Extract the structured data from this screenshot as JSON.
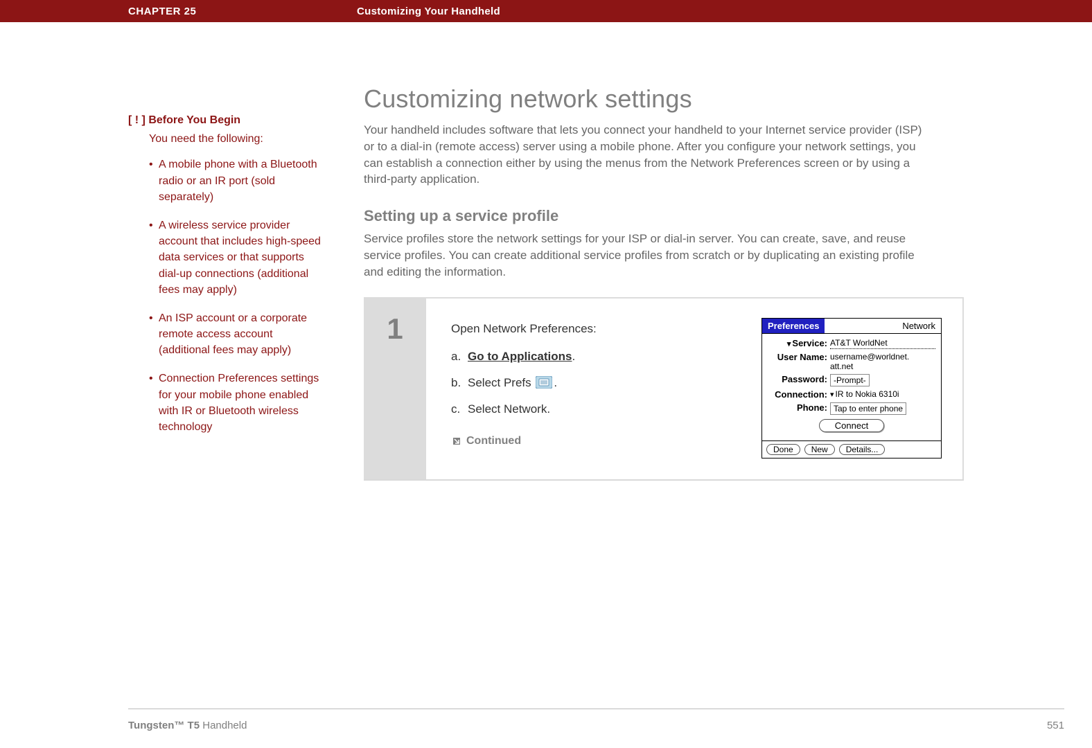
{
  "header": {
    "chapter": "CHAPTER 25",
    "title": "Customizing Your Handheld"
  },
  "sidebar": {
    "bracket_open": "[",
    "bang": " ! ",
    "bracket_close": "]",
    "label": " Before You Begin",
    "intro": "You need the following:",
    "items": [
      "A mobile phone with a Bluetooth radio or an IR port (sold separately)",
      "A wireless service provider account that includes high-speed data services or that supports dial-up connections (additional fees may apply)",
      "An ISP account or a corporate remote access account (additional fees may apply)",
      "Connection Preferences settings for your mobile phone enabled with IR or Bluetooth wireless technology"
    ]
  },
  "main": {
    "h1": "Customizing network settings",
    "intro": "Your handheld includes software that lets you connect your handheld to your Internet service provider (ISP) or to a dial-in (remote access) server using a mobile phone. After you configure your network settings, you can establish a connection either by using the menus from the Network Preferences screen or by using a third-party application.",
    "h2": "Setting up a service profile",
    "sub": "Service profiles store the network settings for your ISP or dial-in server. You can create, save, and reuse service profiles. You can create additional service profiles from scratch or by duplicating an existing profile and editing the information.",
    "step": {
      "num": "1",
      "lead": "Open Network Preferences:",
      "a_letter": "a.",
      "a_link": "Go to Applications",
      "a_after": ".",
      "b_letter": "b.",
      "b_before": "Select Prefs ",
      "b_after": ".",
      "c_letter": "c.",
      "c_text": "Select Network.",
      "continued": "Continued"
    }
  },
  "palm": {
    "title_left": "Preferences",
    "title_right": "Network",
    "service_label": "Service:",
    "service_value": "AT&T WorldNet",
    "user_label": "User Name:",
    "user_value_1": "username@worldnet.",
    "user_value_2": "att.net",
    "password_label": "Password:",
    "password_value": "-Prompt-",
    "connection_label": "Connection:",
    "connection_value": "IR to Nokia 6310i",
    "phone_label": "Phone:",
    "phone_value": "Tap to enter phone",
    "connect_btn": "Connect",
    "done_btn": "Done",
    "new_btn": "New",
    "details_btn": "Details..."
  },
  "footer": {
    "product_bold": "Tungsten™ T5",
    "product_rest": " Handheld",
    "page": "551"
  }
}
